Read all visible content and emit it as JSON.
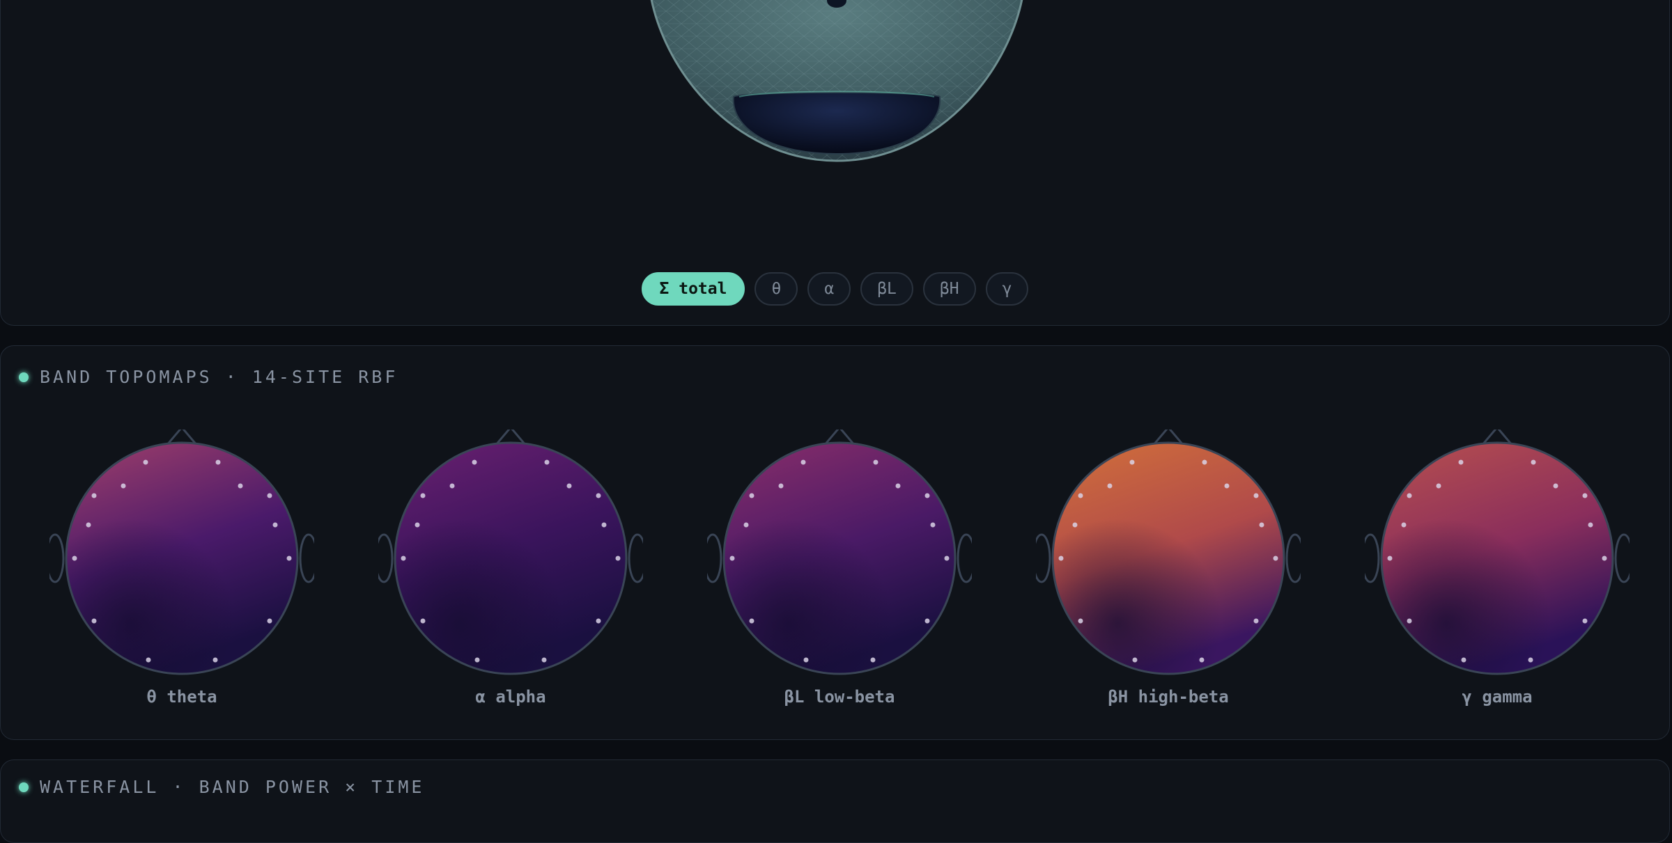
{
  "band_selector": {
    "items": [
      {
        "label": "Σ total",
        "active": true
      },
      {
        "label": "θ",
        "active": false
      },
      {
        "label": "α",
        "active": false
      },
      {
        "label": "βL",
        "active": false
      },
      {
        "label": "βH",
        "active": false
      },
      {
        "label": "γ",
        "active": false
      }
    ]
  },
  "topomaps": {
    "title": "BAND TOPOMAPS · 14-SITE RBF",
    "maps": [
      {
        "label": "θ theta",
        "colors": {
          "top": "#a03f6a",
          "mid": "#4a1a6a",
          "bottom": "#1a1040"
        }
      },
      {
        "label": "α alpha",
        "colors": {
          "top": "#6a2070",
          "mid": "#3a145c",
          "bottom": "#1a1040"
        }
      },
      {
        "label": "βL low-beta",
        "colors": {
          "top": "#8a2e6a",
          "mid": "#4a1a66",
          "bottom": "#1a1040"
        }
      },
      {
        "label": "βH high-beta",
        "colors": {
          "top": "#d2703a",
          "mid": "#b04a4a",
          "bottom": "#3a1660"
        }
      },
      {
        "label": "γ gamma",
        "colors": {
          "top": "#b8504e",
          "mid": "#8a2e5c",
          "bottom": "#2a1258"
        }
      }
    ]
  },
  "waterfall": {
    "title": "WATERFALL · BAND POWER × TIME"
  },
  "accent_color": "#6fd8bd"
}
